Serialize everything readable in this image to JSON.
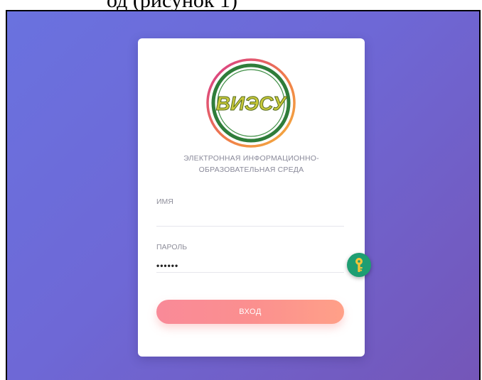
{
  "document": {
    "caption": "од (рисунок 1)"
  },
  "login": {
    "logo_text": "ВИЭСУ",
    "subtitle_line1": "ЭЛЕКТРОННАЯ ИНФОРМАЦИОННО-",
    "subtitle_line2": "ОБРАЗОВАТЕЛЬНАЯ СРЕДА",
    "username_label": "ИМЯ",
    "username_value": "",
    "password_label": "ПАРОЛЬ",
    "password_value": "••••••",
    "submit_label": "ВХОД"
  },
  "icons": {
    "password_manager": "key-icon"
  },
  "colors": {
    "background_start": "#6a72df",
    "background_end": "#7456b8",
    "button_start": "#f98a98",
    "button_end": "#ffa088",
    "key_badge": "#1e9e72",
    "logo_ring_outer": "#d94a8a",
    "logo_ring_inner": "#2f7d3a",
    "logo_text": "#c9c93a"
  }
}
